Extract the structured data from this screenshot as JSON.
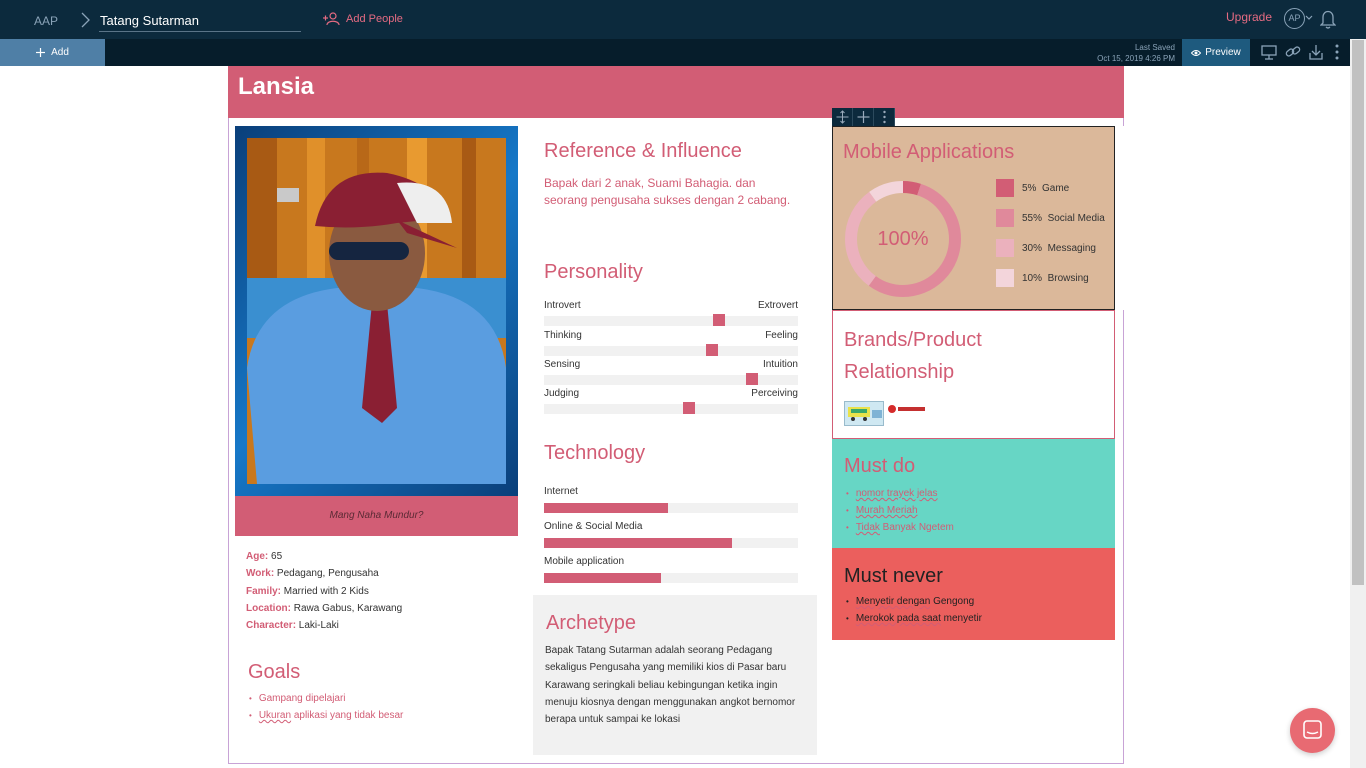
{
  "topbar": {
    "root": "AAP",
    "persona_name": "Tatang Sutarman",
    "add_people": "Add People",
    "upgrade": "Upgrade",
    "avatar_initials": "AP"
  },
  "subbar": {
    "add_label": "Add",
    "last_saved_label": "Last Saved",
    "last_saved_time": "Oct 15, 2019 4:26 PM",
    "preview_label": "Preview"
  },
  "persona": {
    "title": "Lansia",
    "photo_caption": "Mang Naha Mundur?",
    "details": [
      {
        "label": "Age:",
        "value": " 65"
      },
      {
        "label": "Work:",
        "value": " Pedagang, Pengusaha"
      },
      {
        "label": "Family:",
        "value": " Married with 2 Kids"
      },
      {
        "label": "Location:",
        "value": " Rawa Gabus, Karawang"
      },
      {
        "label": "Character:",
        "value": " Laki-Laki"
      }
    ]
  },
  "goals": {
    "heading": "Goals",
    "items": [
      {
        "a": "",
        "u": "",
        "b": "Gampang dipelajari"
      },
      {
        "a": "",
        "u": "Ukuran",
        "b": " aplikasi yang tidak besar"
      }
    ]
  },
  "reference": {
    "heading": "Reference & Influence",
    "text": "Bapak dari 2 anak, Suami Bahagia. dan seorang pengusaha sukses dengan 2 cabang."
  },
  "personality": {
    "heading": "Personality",
    "traits": [
      {
        "left": "Introvert",
        "right": "Extrovert",
        "value": 0.69
      },
      {
        "left": "Thinking",
        "right": "Feeling",
        "value": 0.66
      },
      {
        "left": "Sensing",
        "right": "Intuition",
        "value": 0.82
      },
      {
        "left": "Judging",
        "right": "Perceiving",
        "value": 0.57
      }
    ]
  },
  "technology": {
    "heading": "Technology",
    "items": [
      {
        "label": "Internet",
        "value": 0.49
      },
      {
        "label": "Online & Social Media",
        "value": 0.74
      },
      {
        "label": "Mobile application",
        "value": 0.46
      }
    ]
  },
  "archetype": {
    "heading": "Archetype",
    "text": "Bapak Tatang Sutarman adalah seorang Pedagang sekaligus Pengusaha yang memiliki kios di Pasar baru Karawang seringkali beliau kebingungan ketika ingin menuju kiosnya dengan menggunakan angkot bernomor berapa untuk sampai ke lokasi"
  },
  "mobile_apps": {
    "heading": "Mobile Applications",
    "center_label": "100%",
    "colors": {
      "box_bg": "#dbb89a",
      "accent": "#d25d75"
    },
    "chart_data": {
      "type": "pie",
      "categories": [
        "Game",
        "Social Media",
        "Messaging",
        "Browsing"
      ],
      "values": [
        5,
        55,
        30,
        10
      ],
      "colors": [
        "#d25d75",
        "#e0899b",
        "#ebb1bd",
        "#f3d5db"
      ]
    },
    "legend": [
      {
        "pct": "5%",
        "name": "Game"
      },
      {
        "pct": "55%",
        "name": "Social Media"
      },
      {
        "pct": "30%",
        "name": "Messaging"
      },
      {
        "pct": "10%",
        "name": "Browsing"
      }
    ]
  },
  "brands": {
    "heading_line1": "Brands/Product",
    "heading_line2": "Relationship"
  },
  "must_do": {
    "heading": "Must do",
    "items": [
      {
        "u": "nomor trayek jelas",
        "b": ""
      },
      {
        "u": "Murah Meriah",
        "b": ""
      },
      {
        "u": "Tidak",
        "b": " Banyak Ngetem"
      }
    ]
  },
  "must_never": {
    "heading": "Must never",
    "items": [
      {
        "a": "",
        "u": "Menyetir dengan",
        "b": " Gengong"
      },
      {
        "a": "",
        "u": "Merokok pada saat",
        "b": " menyetir"
      }
    ]
  }
}
